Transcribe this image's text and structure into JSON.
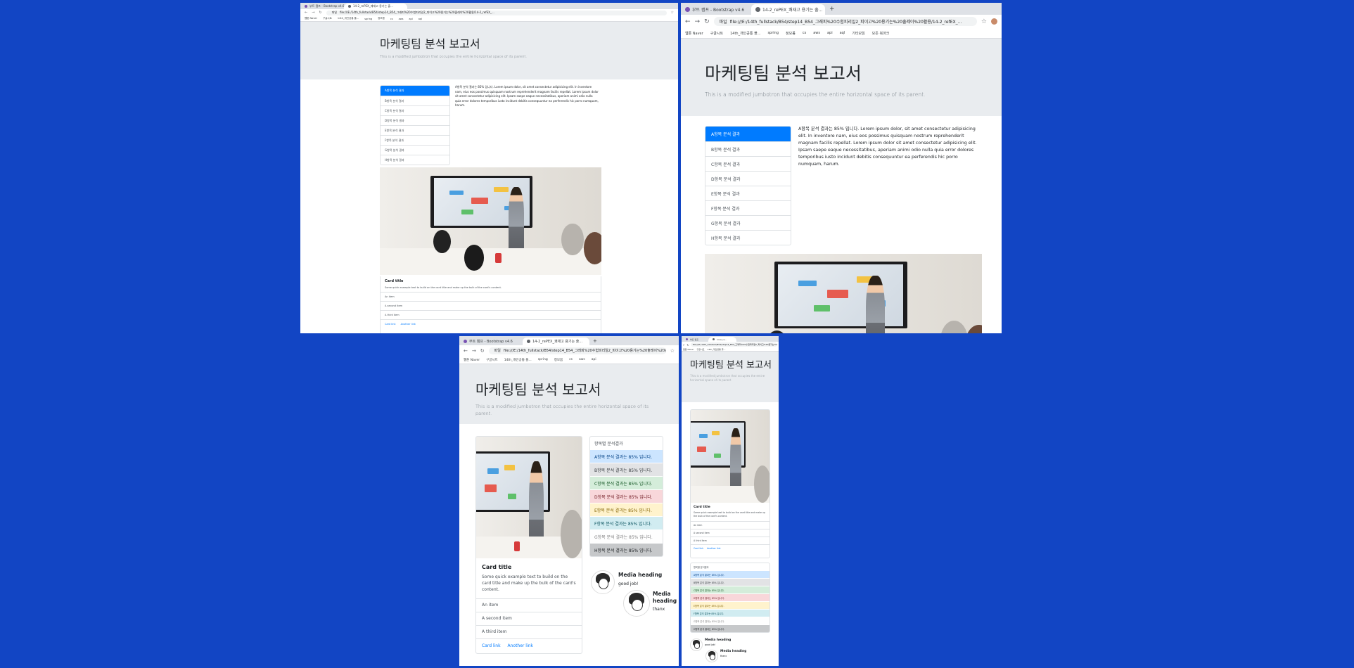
{
  "browser": {
    "tabs": [
      "부트 캠프 - Bootstrap v4.6",
      "14-2_rePEX_쾌재고 용기는 출..."
    ],
    "tabs_short": [
      "부트 캠프",
      "14-2_re..."
    ],
    "address_prefix": "파일",
    "address": "file:///E:/14th_fullstack/B54/step14_B54_그래피%20수험피리일2_피이고%20용기는%20출레이%20활용/14-2_refEX_...",
    "bookmarks": [
      "웹툰 Naver",
      "구글시트",
      "14th_개인공통 폴...",
      "spring",
      "정모몸",
      "cs",
      "aws",
      "api",
      "aql",
      "기타모임",
      "ppt",
      "react",
      "모든 북마크"
    ]
  },
  "page": {
    "title": "마케팅팀 분석 보고서",
    "lead": "This is a modified jumbotron that occupies the entire horizontal space of its parent.",
    "list_items": [
      "A항목 분석 결과",
      "B항목 분석 결과",
      "C항목 분석 결과",
      "D항목 분석 결과",
      "E항목 분석 결과",
      "F항목 분석 결과",
      "G항목 분석 결과",
      "H항목 분석 결과"
    ],
    "analysis_text": "A항목 분석 결과는 85% 입니다. Lorem ipsum dolor, sit amet consectetur adipisicing elit. In inventore nam, eius eos possimus quisquam nostrum reprehenderit magnam facilis repellat. Lorem ipsum dolor sit amet consectetur adipisicing elit. Ipsam saepe eaque necessitatibus, aperiam animi odio nulla quia error dolores temporibus iusto incidunt debitis consequuntur ea perferendis hic porro numquam, harum.",
    "card": {
      "title": "Card title",
      "text": "Some quick example text to build on the card title and make up the bulk of the card's content.",
      "items": [
        "An item",
        "A second item",
        "A third item"
      ],
      "links": [
        "Card link",
        "Another link"
      ]
    },
    "colored_list": {
      "header": "항목별 분석결과",
      "items": [
        "A항목 분석 결과는 85% 입니다.",
        "B항목 분석 결과는 85% 입니다.",
        "C항목 분석 결과는 85% 입니다.",
        "D항목 분석 결과는 85% 입니다.",
        "E항목 분석 결과는 85% 입니다.",
        "F항목 분석 결과는 85% 입니다.",
        "G항목 분석 결과는 85% 입니다.",
        "H항목 분석 결과는 85% 입니다."
      ]
    },
    "media": [
      {
        "heading": "Media heading",
        "text": "good job!"
      },
      {
        "heading": "Media heading",
        "text": "thanx"
      }
    ]
  },
  "colors": {
    "desktop_bg": "#1245c4",
    "primary": "#007bff",
    "jumbotron_bg": "#e9ecef"
  }
}
